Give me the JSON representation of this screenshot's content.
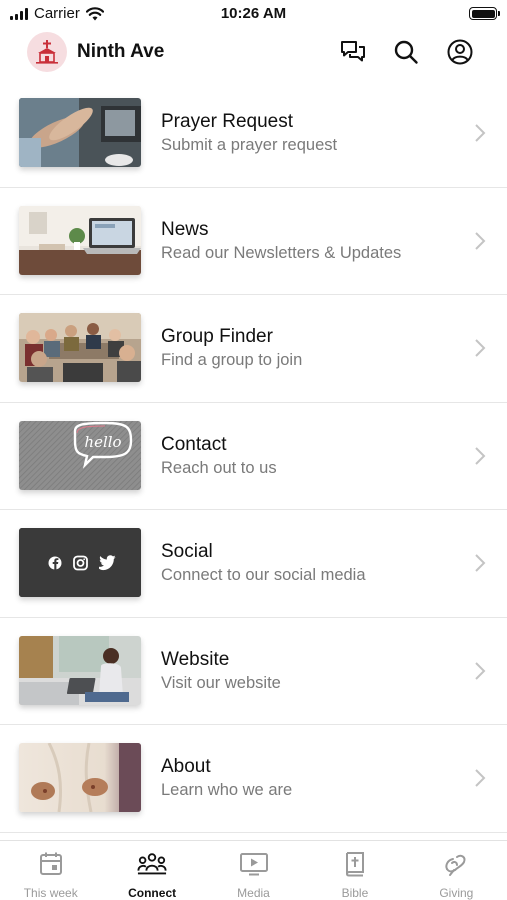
{
  "status_bar": {
    "carrier": "Carrier",
    "time": "10:26 AM",
    "battery_level": 1.0
  },
  "header": {
    "title": "Ninth Ave",
    "icons": [
      "logo-icon",
      "chat-icon",
      "search-icon",
      "profile-icon"
    ]
  },
  "list": {
    "items": [
      {
        "title": "Prayer Request",
        "subtitle": "Submit a prayer request",
        "thumb": "praying-hands-photo"
      },
      {
        "title": "News",
        "subtitle": "Read our Newsletters & Updates",
        "thumb": "laptop-desk-photo"
      },
      {
        "title": "Group Finder",
        "subtitle": "Find a group to join",
        "thumb": "group-meeting-photo"
      },
      {
        "title": "Contact",
        "subtitle": "Reach out to us",
        "thumb": "hello-sign-photo"
      },
      {
        "title": "Social",
        "subtitle": "Connect to our social media",
        "thumb": "social-icons-tile"
      },
      {
        "title": "Website",
        "subtitle": "Visit our website",
        "thumb": "woman-laptop-photo"
      },
      {
        "title": "About",
        "subtitle": "Learn who we are",
        "thumb": "hands-photo"
      }
    ]
  },
  "tab_bar": {
    "tabs": [
      {
        "label": "This week",
        "icon": "calendar-icon",
        "active": false
      },
      {
        "label": "Connect",
        "icon": "people-icon",
        "active": true
      },
      {
        "label": "Media",
        "icon": "play-icon",
        "active": false
      },
      {
        "label": "Bible",
        "icon": "bible-icon",
        "active": false
      },
      {
        "label": "Giving",
        "icon": "giving-icon",
        "active": false
      }
    ]
  },
  "colors": {
    "accent": "#111111",
    "muted_text": "#7a7a7a",
    "inactive_tab": "#9a9a9a",
    "divider": "#e6e6e6",
    "logo_bg": "#f6dde0",
    "logo_fg": "#c9303a"
  }
}
